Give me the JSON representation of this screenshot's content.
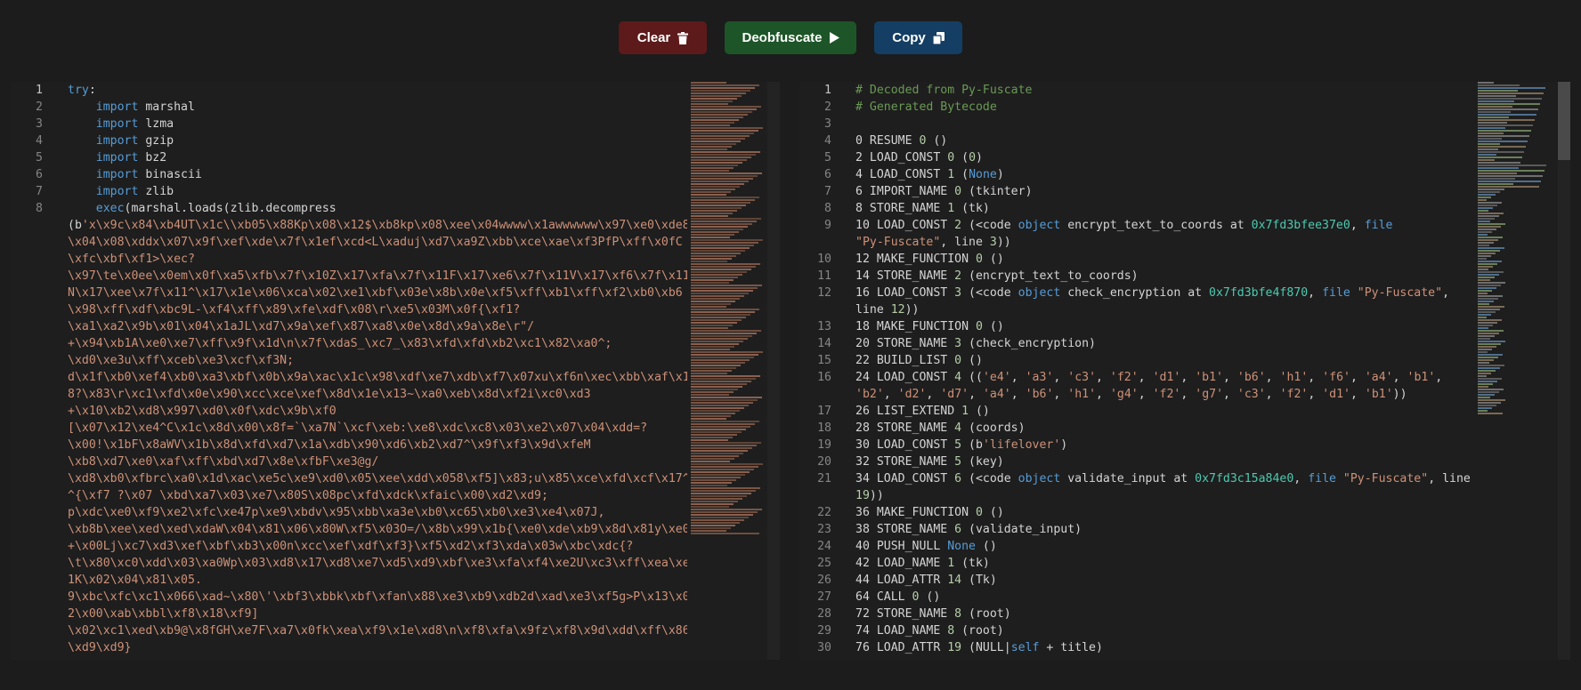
{
  "toolbar": {
    "clear_label": "Clear",
    "deobfuscate_label": "Deobfuscate",
    "copy_label": "Copy",
    "clear_icon": "trash-icon",
    "deobfuscate_icon": "play-icon",
    "copy_icon": "copy-icon"
  },
  "colors": {
    "background": "#1c1c1c",
    "editor_bg": "#1e1e1e",
    "clear": "#5c1a1a",
    "deobfuscate": "#1d5528",
    "copy": "#143e63",
    "keyword": "#569cd6",
    "string": "#ce9178",
    "comment": "#6a9955",
    "number": "#b5cea8",
    "hex": "#4ec9b0"
  },
  "input_editor": {
    "lines": [
      {
        "num": "1",
        "tokens": [
          [
            "k",
            "try"
          ],
          [
            "p",
            ":"
          ]
        ]
      },
      {
        "num": "2",
        "tokens": [
          [
            "p",
            "    "
          ],
          [
            "k",
            "import"
          ],
          [
            "p",
            " marshal"
          ]
        ]
      },
      {
        "num": "3",
        "tokens": [
          [
            "p",
            "    "
          ],
          [
            "k",
            "import"
          ],
          [
            "p",
            " lzma"
          ]
        ]
      },
      {
        "num": "4",
        "tokens": [
          [
            "p",
            "    "
          ],
          [
            "k",
            "import"
          ],
          [
            "p",
            " gzip"
          ]
        ]
      },
      {
        "num": "5",
        "tokens": [
          [
            "p",
            "    "
          ],
          [
            "k",
            "import"
          ],
          [
            "p",
            " bz2"
          ]
        ]
      },
      {
        "num": "6",
        "tokens": [
          [
            "p",
            "    "
          ],
          [
            "k",
            "import"
          ],
          [
            "p",
            " binascii"
          ]
        ]
      },
      {
        "num": "7",
        "tokens": [
          [
            "p",
            "    "
          ],
          [
            "k",
            "import"
          ],
          [
            "p",
            " zlib"
          ]
        ]
      },
      {
        "num": "8",
        "tokens": [
          [
            "p",
            "    "
          ],
          [
            "k",
            "exec"
          ],
          [
            "p",
            "(marshal.loads(zlib.decompress\n(b"
          ],
          [
            "s",
            "'x\\x9c\\x84\\xb4UT\\x1c\\\\xb05\\x88Kp\\x08\\x12$\\xb8kp\\x08\\xee\\x04wwww\\x1awwwwww\\x97\\xe0\\xde8\\x04\\x08\\xddx\\x07\\x9f\\xef\\xde\\x7f\\x1ef\\xcd<L\\xaduj\\xd7\\xa9Z\\xbb\\xce\\xae\\xf3PfP\\xff\\x0fC\\xfc\\xbf\\xf1>\\xec?\n\\x97\\te\\x0ee\\x0em\\x0f\\xa5\\xfb\\x7f\\x10Z\\x17\\xfa\\x7f\\x11F\\x17\\xe6\\x7f\\x11V\\x17\\xf6\\x7f\\x11N\\x17\\xee\\x7f\\x11^\\x17\\x1e\\x06\\xca\\x02\\xe1\\xbf\\x03e\\x8b\\x0e\\xf5\\xff\\xb1\\xff\\xf2\\xb0\\xb6\\x98\\xff\\xdf\\xbc9L-\\xf4\\xff\\x89\\xfe\\xdf\\x08\\r\\xe5\\x03M\\x0f{\\xf1?\n\\xa1\\xa2\\x9b\\x01\\x04\\x1aJL\\xd7\\x9a\\xef\\x87\\xa8\\x0e\\x8d\\x9a\\x8e\\r\"/\n+\\x94\\xb1A\\xe0\\xe7\\xff\\x9f\\x1d\\n\\x7f\\xdaS_\\xc7_\\x83\\xfd\\xfd\\xb2\\xc1\\x82\\xa0^;\n\\xd0\\xe3u\\xff\\xceb\\xe3\\xcf\\xf3N;\nd\\x1f\\xb0\\xef4\\xb0\\xa3\\xbf\\x0b\\x9a\\xac\\x1c\\x98\\xdf\\xe7\\xdb\\xf7\\x07xu\\xf6n\\xec\\xbb\\xaf\\x18?\\x83\\r\\xc1\\xfd\\x0e\\x90\\xcc\\xce\\xef\\x8d\\x1e\\x13~\\xa0\\xeb\\x8d\\xf2i\\xc0\\xd3\n+\\x10\\xb2\\xd8\\x997\\xd0\\x0f\\xdc\\x9b\\xf0\n[\\x07\\x12\\xe4^C\\x1c\\x8d\\x00\\x8f=`\\xa7N`\\xcf\\xeb:\\xe8\\xdc\\xc8\\x03\\xe2\\x07\\x04\\xdd=?\n\\x00!\\x1bF\\x8aWV\\x1b\\x8d\\xfd\\xd7\\x1a\\xdb\\x90\\xd6\\xb2\\xd7^\\x9f\\xf3\\x9d\\xfeM\n\\xb8\\xd7\\xe0\\xaf\\xff\\xbd\\xd7\\x8e\\xfbF\\xe3@g/\n\\xd8\\xb0\\xfbrc\\xa0\\x1d\\xac\\xe5c\\xe9\\xd0\\x05\\xee\\xdd\\x058\\xf5]\\x83;u\\x85\\xce\\xfd\\xcf\\x17^^{\\xf7 ?\\x07 \\xbd\\xa7\\x03\\xe7\\x80S\\x08pc\\xfd\\xdck\\xfaic\\x00\\xd2\\xd9;\np\\xdc\\xe0\\xf9\\xe2\\xfc\\xe47p\\xe9\\xbdv\\x95\\xbb\\xa3e\\xb0\\xc65\\xb0\\xe3\\xe4\\x07J,\n\\xb8b\\xee\\xed\\xed\\xdaW\\x04\\x81\\x06\\x80W\\xf5\\x03O=/\\x8b\\x99\\x1b{\\xe0\\xde\\xb9\\x8d\\x81y\\xe0+\\x00Lj\\xc7\\xd3\\xef\\xbf\\xb3\\x00n\\xcc\\xef\\xdf\\xf3}\\xf5\\xd2\\xf3\\xda\\x03w\\xbc\\xdc{?\n\\t\\x80\\xc0\\xdd\\x03\\xa0Wp\\x03\\xd8\\x17\\xd8\\xe7\\xd5\\xd9\\xbf\\xe3\\xfa\\xf4\\xe2U\\xc3\\xff\\xea\\xe1K\\x02\\x04\\x81\\x05.\n9\\xbc\\xfc\\xc1\\x066\\xad~\\x80\\'\\xbf3\\xbbk\\xbf\\xfan\\x88\\xe3\\xb9\\xdb2d\\xad\\xe3\\xf5g>P\\x13\\x02\\x00\\xab\\xbbl\\xf8\\x18\\xf9]\n\\x02\\xc1\\xed\\xb9@\\x8fGH\\xe7F\\xa7\\x0fk\\xea\\xf9\\x1e\\xd8\\n\\xf8\\xfa\\x9fz\\xf8\\x9d\\xdd\\xff\\x86\\xd9\\xd9}"
          ]
        ]
      }
    ]
  },
  "output_editor": {
    "lines": [
      {
        "num": "1",
        "tokens": [
          [
            "c",
            "# Decoded from Py-Fuscate"
          ]
        ]
      },
      {
        "num": "2",
        "tokens": [
          [
            "c",
            "# Generated Bytecode"
          ]
        ]
      },
      {
        "num": "3",
        "tokens": [
          [
            "p",
            ""
          ]
        ]
      },
      {
        "num": "4",
        "tokens": [
          [
            "p",
            "0 RESUME "
          ],
          [
            "n",
            "0"
          ],
          [
            "p",
            " ()"
          ]
        ]
      },
      {
        "num": "5",
        "tokens": [
          [
            "p",
            "2 LOAD_CONST "
          ],
          [
            "n",
            "0"
          ],
          [
            "p",
            " ("
          ],
          [
            "n",
            "0"
          ],
          [
            "p",
            ")"
          ]
        ]
      },
      {
        "num": "6",
        "tokens": [
          [
            "p",
            "4 LOAD_CONST "
          ],
          [
            "n",
            "1"
          ],
          [
            "p",
            " ("
          ],
          [
            "k",
            "None"
          ],
          [
            "p",
            ")"
          ]
        ]
      },
      {
        "num": "7",
        "tokens": [
          [
            "p",
            "6 IMPORT_NAME "
          ],
          [
            "n",
            "0"
          ],
          [
            "p",
            " (tkinter)"
          ]
        ]
      },
      {
        "num": "8",
        "tokens": [
          [
            "p",
            "8 STORE_NAME "
          ],
          [
            "n",
            "1"
          ],
          [
            "p",
            " (tk)"
          ]
        ]
      },
      {
        "num": "9",
        "tokens": [
          [
            "p",
            "10 LOAD_CONST "
          ],
          [
            "n",
            "2"
          ],
          [
            "p",
            " (<code "
          ],
          [
            "k",
            "object"
          ],
          [
            "p",
            " encrypt_text_to_coords at "
          ],
          [
            "h",
            "0x7fd3bfee37e0"
          ],
          [
            "p",
            ", "
          ],
          [
            "k",
            "file"
          ],
          [
            "p",
            "\n"
          ],
          [
            "s",
            "\"Py-Fuscate\""
          ],
          [
            "p",
            ", line "
          ],
          [
            "n",
            "3"
          ],
          [
            "p",
            "))"
          ]
        ]
      },
      {
        "num": "10",
        "tokens": [
          [
            "p",
            "12 MAKE_FUNCTION "
          ],
          [
            "n",
            "0"
          ],
          [
            "p",
            " ()"
          ]
        ]
      },
      {
        "num": "11",
        "tokens": [
          [
            "p",
            "14 STORE_NAME "
          ],
          [
            "n",
            "2"
          ],
          [
            "p",
            " (encrypt_text_to_coords)"
          ]
        ]
      },
      {
        "num": "12",
        "tokens": [
          [
            "p",
            "16 LOAD_CONST "
          ],
          [
            "n",
            "3"
          ],
          [
            "p",
            " (<code "
          ],
          [
            "k",
            "object"
          ],
          [
            "p",
            " check_encryption at "
          ],
          [
            "h",
            "0x7fd3bfe4f870"
          ],
          [
            "p",
            ", "
          ],
          [
            "k",
            "file"
          ],
          [
            "p",
            " "
          ],
          [
            "s",
            "\"Py-Fuscate\""
          ],
          [
            "p",
            ",\nline "
          ],
          [
            "n",
            "12"
          ],
          [
            "p",
            "))"
          ]
        ]
      },
      {
        "num": "13",
        "tokens": [
          [
            "p",
            "18 MAKE_FUNCTION "
          ],
          [
            "n",
            "0"
          ],
          [
            "p",
            " ()"
          ]
        ]
      },
      {
        "num": "14",
        "tokens": [
          [
            "p",
            "20 STORE_NAME "
          ],
          [
            "n",
            "3"
          ],
          [
            "p",
            " (check_encryption)"
          ]
        ]
      },
      {
        "num": "15",
        "tokens": [
          [
            "p",
            "22 BUILD_LIST "
          ],
          [
            "n",
            "0"
          ],
          [
            "p",
            " ()"
          ]
        ]
      },
      {
        "num": "16",
        "tokens": [
          [
            "p",
            "24 LOAD_CONST "
          ],
          [
            "n",
            "4"
          ],
          [
            "p",
            " (("
          ],
          [
            "s",
            "'e4'"
          ],
          [
            "p",
            ", "
          ],
          [
            "s",
            "'a3'"
          ],
          [
            "p",
            ", "
          ],
          [
            "s",
            "'c3'"
          ],
          [
            "p",
            ", "
          ],
          [
            "s",
            "'f2'"
          ],
          [
            "p",
            ", "
          ],
          [
            "s",
            "'d1'"
          ],
          [
            "p",
            ", "
          ],
          [
            "s",
            "'b1'"
          ],
          [
            "p",
            ", "
          ],
          [
            "s",
            "'b6'"
          ],
          [
            "p",
            ", "
          ],
          [
            "s",
            "'h1'"
          ],
          [
            "p",
            ", "
          ],
          [
            "s",
            "'f6'"
          ],
          [
            "p",
            ", "
          ],
          [
            "s",
            "'a4'"
          ],
          [
            "p",
            ", "
          ],
          [
            "s",
            "'b1'"
          ],
          [
            "p",
            ",\n"
          ],
          [
            "s",
            "'b2'"
          ],
          [
            "p",
            ", "
          ],
          [
            "s",
            "'d2'"
          ],
          [
            "p",
            ", "
          ],
          [
            "s",
            "'d7'"
          ],
          [
            "p",
            ", "
          ],
          [
            "s",
            "'a4'"
          ],
          [
            "p",
            ", "
          ],
          [
            "s",
            "'b6'"
          ],
          [
            "p",
            ", "
          ],
          [
            "s",
            "'h1'"
          ],
          [
            "p",
            ", "
          ],
          [
            "s",
            "'g4'"
          ],
          [
            "p",
            ", "
          ],
          [
            "s",
            "'f2'"
          ],
          [
            "p",
            ", "
          ],
          [
            "s",
            "'g7'"
          ],
          [
            "p",
            ", "
          ],
          [
            "s",
            "'c3'"
          ],
          [
            "p",
            ", "
          ],
          [
            "s",
            "'f2'"
          ],
          [
            "p",
            ", "
          ],
          [
            "s",
            "'d1'"
          ],
          [
            "p",
            ", "
          ],
          [
            "s",
            "'b1'"
          ],
          [
            "p",
            "))"
          ]
        ]
      },
      {
        "num": "17",
        "tokens": [
          [
            "p",
            "26 LIST_EXTEND "
          ],
          [
            "n",
            "1"
          ],
          [
            "p",
            " ()"
          ]
        ]
      },
      {
        "num": "18",
        "tokens": [
          [
            "p",
            "28 STORE_NAME "
          ],
          [
            "n",
            "4"
          ],
          [
            "p",
            " (coords)"
          ]
        ]
      },
      {
        "num": "19",
        "tokens": [
          [
            "p",
            "30 LOAD_CONST "
          ],
          [
            "n",
            "5"
          ],
          [
            "p",
            " (b"
          ],
          [
            "s",
            "'lifelover'"
          ],
          [
            "p",
            ")"
          ]
        ]
      },
      {
        "num": "20",
        "tokens": [
          [
            "p",
            "32 STORE_NAME "
          ],
          [
            "n",
            "5"
          ],
          [
            "p",
            " (key)"
          ]
        ]
      },
      {
        "num": "21",
        "tokens": [
          [
            "p",
            "34 LOAD_CONST "
          ],
          [
            "n",
            "6"
          ],
          [
            "p",
            " (<code "
          ],
          [
            "k",
            "object"
          ],
          [
            "p",
            " validate_input at "
          ],
          [
            "h",
            "0x7fd3c15a84e0"
          ],
          [
            "p",
            ", "
          ],
          [
            "k",
            "file"
          ],
          [
            "p",
            " "
          ],
          [
            "s",
            "\"Py-Fuscate\""
          ],
          [
            "p",
            ", line\n"
          ],
          [
            "n",
            "19"
          ],
          [
            "p",
            "))"
          ]
        ]
      },
      {
        "num": "22",
        "tokens": [
          [
            "p",
            "36 MAKE_FUNCTION "
          ],
          [
            "n",
            "0"
          ],
          [
            "p",
            " ()"
          ]
        ]
      },
      {
        "num": "23",
        "tokens": [
          [
            "p",
            "38 STORE_NAME "
          ],
          [
            "n",
            "6"
          ],
          [
            "p",
            " (validate_input)"
          ]
        ]
      },
      {
        "num": "24",
        "tokens": [
          [
            "p",
            "40 PUSH_NULL "
          ],
          [
            "k",
            "None"
          ],
          [
            "p",
            " ()"
          ]
        ]
      },
      {
        "num": "25",
        "tokens": [
          [
            "p",
            "42 LOAD_NAME "
          ],
          [
            "n",
            "1"
          ],
          [
            "p",
            " (tk)"
          ]
        ]
      },
      {
        "num": "26",
        "tokens": [
          [
            "p",
            "44 LOAD_ATTR "
          ],
          [
            "n",
            "14"
          ],
          [
            "p",
            " (Tk)"
          ]
        ]
      },
      {
        "num": "27",
        "tokens": [
          [
            "p",
            "64 CALL "
          ],
          [
            "n",
            "0"
          ],
          [
            "p",
            " ()"
          ]
        ]
      },
      {
        "num": "28",
        "tokens": [
          [
            "p",
            "72 STORE_NAME "
          ],
          [
            "n",
            "8"
          ],
          [
            "p",
            " (root)"
          ]
        ]
      },
      {
        "num": "29",
        "tokens": [
          [
            "p",
            "74 LOAD_NAME "
          ],
          [
            "n",
            "8"
          ],
          [
            "p",
            " (root)"
          ]
        ]
      },
      {
        "num": "30",
        "tokens": [
          [
            "p",
            "76 LOAD_ATTR "
          ],
          [
            "n",
            "19"
          ],
          [
            "p",
            " (NULL|"
          ],
          [
            "k",
            "self"
          ],
          [
            "p",
            " + title)"
          ]
        ]
      }
    ]
  }
}
